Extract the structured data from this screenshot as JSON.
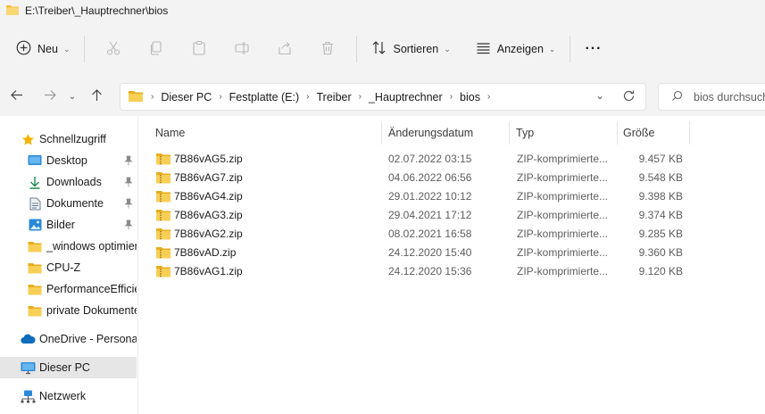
{
  "window": {
    "title": "E:\\Treiber\\_Hauptrechner\\bios"
  },
  "toolbar": {
    "new_label": "Neu",
    "sort_label": "Sortieren",
    "view_label": "Anzeigen",
    "more_label": "···"
  },
  "address": {
    "breadcrumbs": [
      "Dieser PC",
      "Festplatte (E:)",
      "Treiber",
      "_Hauptrechner",
      "bios"
    ],
    "search_placeholder": "bios durchsuchen"
  },
  "sidebar": {
    "items": [
      {
        "label": "Schnellzugriff",
        "icon": "star-icon",
        "pinned": false
      },
      {
        "label": "Desktop",
        "icon": "desktop-icon",
        "pinned": true
      },
      {
        "label": "Downloads",
        "icon": "download-icon",
        "pinned": true
      },
      {
        "label": "Dokumente",
        "icon": "document-icon",
        "pinned": true
      },
      {
        "label": "Bilder",
        "icon": "picture-icon",
        "pinned": true
      },
      {
        "label": "_windows optimier",
        "icon": "folder-icon",
        "pinned": false
      },
      {
        "label": "CPU-Z",
        "icon": "folder-icon",
        "pinned": false
      },
      {
        "label": "PerformanceEfficie",
        "icon": "folder-icon",
        "pinned": false
      },
      {
        "label": "private Dokumente",
        "icon": "folder-icon",
        "pinned": false
      },
      {
        "label": "OneDrive - Personal",
        "icon": "cloud-icon",
        "pinned": false
      },
      {
        "label": "Dieser PC",
        "icon": "computer-icon",
        "pinned": false,
        "selected": true
      },
      {
        "label": "Netzwerk",
        "icon": "network-icon",
        "pinned": false
      }
    ]
  },
  "columns": {
    "name": "Name",
    "date": "Änderungsdatum",
    "type": "Typ",
    "size": "Größe"
  },
  "files": [
    {
      "name": "7B86vAG5.zip",
      "date": "02.07.2022 03:15",
      "type": "ZIP-komprimierte...",
      "size": "9.457 KB"
    },
    {
      "name": "7B86vAG7.zip",
      "date": "04.06.2022 06:56",
      "type": "ZIP-komprimierte...",
      "size": "9.548 KB"
    },
    {
      "name": "7B86vAG4.zip",
      "date": "29.01.2022 10:12",
      "type": "ZIP-komprimierte...",
      "size": "9.398 KB"
    },
    {
      "name": "7B86vAG3.zip",
      "date": "29.04.2021 17:12",
      "type": "ZIP-komprimierte...",
      "size": "9.374 KB"
    },
    {
      "name": "7B86vAG2.zip",
      "date": "08.02.2021 16:58",
      "type": "ZIP-komprimierte...",
      "size": "9.285 KB"
    },
    {
      "name": "7B86vAD.zip",
      "date": "24.12.2020 15:40",
      "type": "ZIP-komprimierte...",
      "size": "9.360 KB"
    },
    {
      "name": "7B86vAG1.zip",
      "date": "24.12.2020 15:36",
      "type": "ZIP-komprimierte...",
      "size": "9.120 KB"
    }
  ],
  "colors": {
    "folder": "#f3c13a",
    "accent": "#0067c0",
    "selected_bg": "#e6e6e6"
  }
}
